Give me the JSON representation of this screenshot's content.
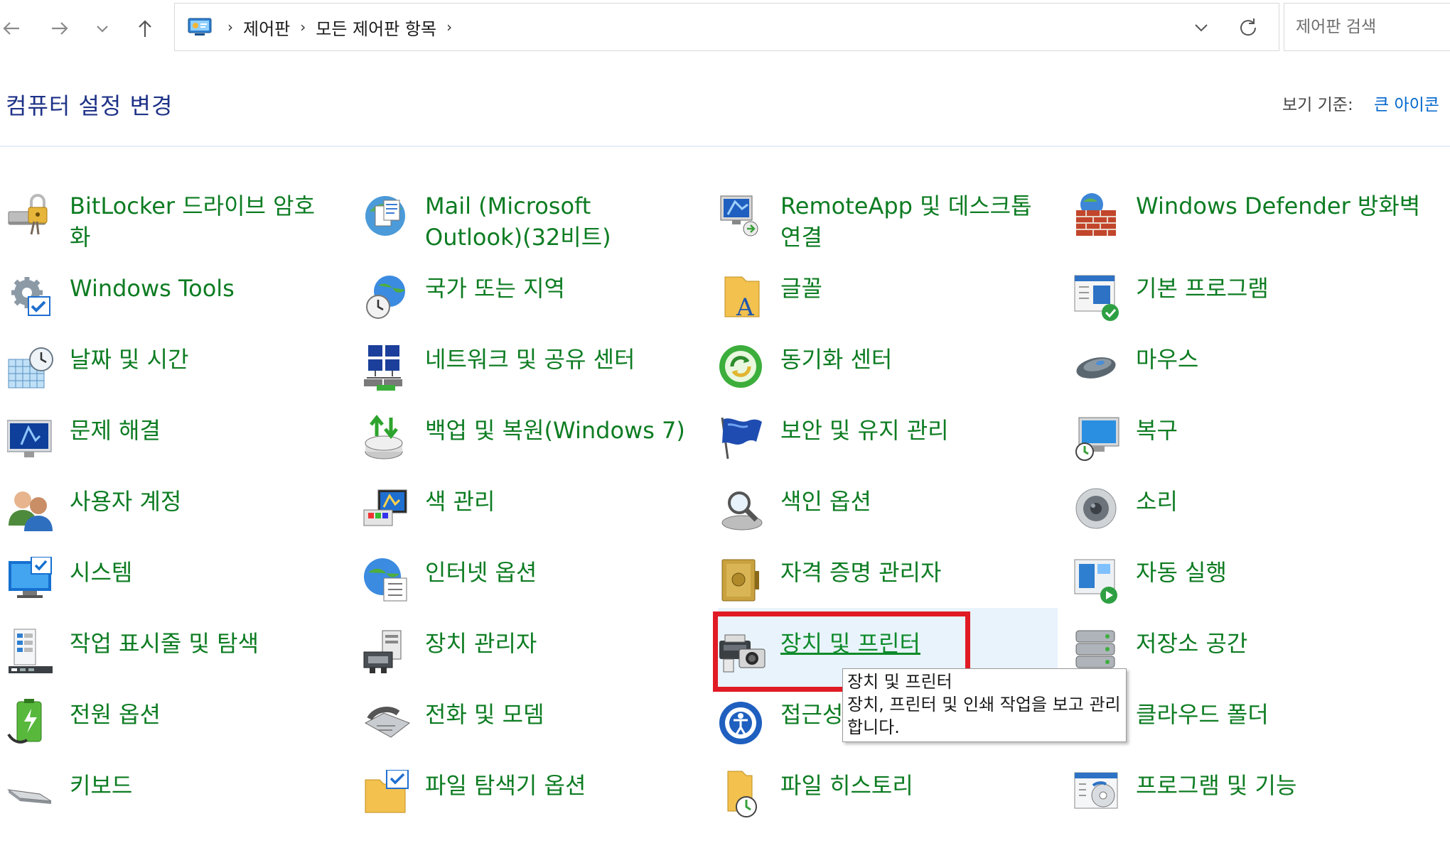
{
  "nav": {
    "back": "back-arrow",
    "forward": "forward-arrow",
    "recent": "chevron-down",
    "up": "up-arrow"
  },
  "address": {
    "crumbs": [
      "제어판",
      "모든 제어판 항목"
    ]
  },
  "search": {
    "placeholder": "제어판 검색"
  },
  "header": {
    "title": "컴퓨터 설정 변경",
    "view_label": "보기 기준:",
    "view_value": "큰 아이콘"
  },
  "items": [
    {
      "label": "BitLocker 드라이브 암호화",
      "icon": "bitlocker-icon"
    },
    {
      "label": "Mail (Microsoft Outlook)(32비트)",
      "icon": "mail-icon"
    },
    {
      "label": "RemoteApp 및 데스크톱 연결",
      "icon": "remoteapp-icon"
    },
    {
      "label": "Windows Defender 방화벽",
      "icon": "firewall-icon"
    },
    {
      "label": "Windows Tools",
      "icon": "windows-tools-icon"
    },
    {
      "label": "국가 또는 지역",
      "icon": "region-icon"
    },
    {
      "label": "글꼴",
      "icon": "fonts-icon"
    },
    {
      "label": "기본 프로그램",
      "icon": "default-programs-icon"
    },
    {
      "label": "날짜 및 시간",
      "icon": "date-time-icon"
    },
    {
      "label": "네트워크 및 공유 센터",
      "icon": "network-icon"
    },
    {
      "label": "동기화 센터",
      "icon": "sync-center-icon"
    },
    {
      "label": "마우스",
      "icon": "mouse-icon"
    },
    {
      "label": "문제 해결",
      "icon": "troubleshoot-icon"
    },
    {
      "label": "백업 및 복원(Windows 7)",
      "icon": "backup-icon"
    },
    {
      "label": "보안 및 유지 관리",
      "icon": "security-flag-icon"
    },
    {
      "label": "복구",
      "icon": "recovery-icon"
    },
    {
      "label": "사용자 계정",
      "icon": "user-accounts-icon"
    },
    {
      "label": "색 관리",
      "icon": "color-management-icon"
    },
    {
      "label": "색인 옵션",
      "icon": "indexing-icon"
    },
    {
      "label": "소리",
      "icon": "sound-icon"
    },
    {
      "label": "시스템",
      "icon": "system-icon"
    },
    {
      "label": "인터넷 옵션",
      "icon": "internet-options-icon"
    },
    {
      "label": "자격 증명 관리자",
      "icon": "credential-icon"
    },
    {
      "label": "자동 실행",
      "icon": "autoplay-icon"
    },
    {
      "label": "작업 표시줄 및 탐색",
      "icon": "taskbar-icon"
    },
    {
      "label": "장치 관리자",
      "icon": "device-manager-icon"
    },
    {
      "label": "장치 및 프린터",
      "icon": "devices-printers-icon"
    },
    {
      "label": "저장소 공간",
      "icon": "storage-spaces-icon"
    },
    {
      "label": "전원 옵션",
      "icon": "power-icon"
    },
    {
      "label": "전화 및 모뎀",
      "icon": "phone-modem-icon"
    },
    {
      "label": "접근성 센터",
      "icon": "ease-of-access-icon"
    },
    {
      "label": "클라우드 폴더",
      "icon": "cloud-folder-icon"
    },
    {
      "label": "키보드",
      "icon": "keyboard-icon"
    },
    {
      "label": "파일 탐색기 옵션",
      "icon": "folder-options-icon"
    },
    {
      "label": "파일 히스토리",
      "icon": "file-history-icon"
    },
    {
      "label": "프로그램 및 기능",
      "icon": "programs-features-icon"
    }
  ],
  "tooltip": {
    "title": "장치 및 프린터",
    "body": "장치, 프린터 및 인쇄 작업을 보고 관리합니다."
  },
  "colors": {
    "link": "#0d7c22",
    "heading": "#1e3287",
    "highlight_box": "#e01b24",
    "hover_bg": "#e8f3fc"
  }
}
